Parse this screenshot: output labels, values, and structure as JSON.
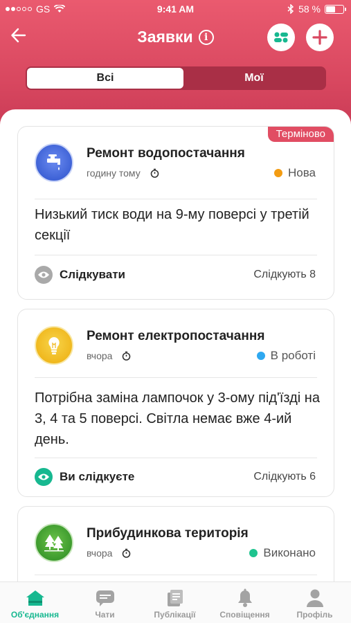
{
  "status_bar": {
    "carrier": "GS",
    "time": "9:41 AM",
    "battery_percent": "58 %",
    "battery_level": 0.58
  },
  "nav": {
    "title": "Заявки",
    "info_icon": "i"
  },
  "segment": {
    "all_label": "Всі",
    "mine_label": "Мої"
  },
  "colors": {
    "header_accent": "#d94860",
    "badge": "#e14d63",
    "active_tab": "#17b890"
  },
  "cards": [
    {
      "badge": "Терміново",
      "icon": "water-tap-icon",
      "title": "Ремонт водопостачання",
      "time": "годину тому",
      "status": "Нова",
      "status_color": "#f39c12",
      "text": "Низький тиск води на 9-му поверсі у третій секції",
      "follow_label": "Слідкувати",
      "followers": "Слідкують 8",
      "following": false
    },
    {
      "icon": "light-bulb-icon",
      "title": "Ремонт електропостачання",
      "time": "вчора",
      "status": "В роботі",
      "status_color": "#2ea8f0",
      "text": "Потрібна заміна лампочок у 3-ому під'їзді на 3, 4 та 5 поверсі. Світла немає вже 4-ий день.",
      "follow_label": "Ви слідкуєте",
      "followers": "Слідкують 6",
      "following": true
    },
    {
      "icon": "trees-icon",
      "title": "Прибудинкова територія",
      "time": "вчора",
      "status": "Виконано",
      "status_color": "#1fc48f"
    }
  ],
  "tabbar": [
    {
      "label": "Об'єднання",
      "icon": "home-icon",
      "active": true
    },
    {
      "label": "Чати",
      "icon": "chat-icon",
      "active": false
    },
    {
      "label": "Публікації",
      "icon": "publications-icon",
      "active": false
    },
    {
      "label": "Сповіщення",
      "icon": "bell-icon",
      "active": false
    },
    {
      "label": "Профіль",
      "icon": "profile-icon",
      "active": false
    }
  ]
}
